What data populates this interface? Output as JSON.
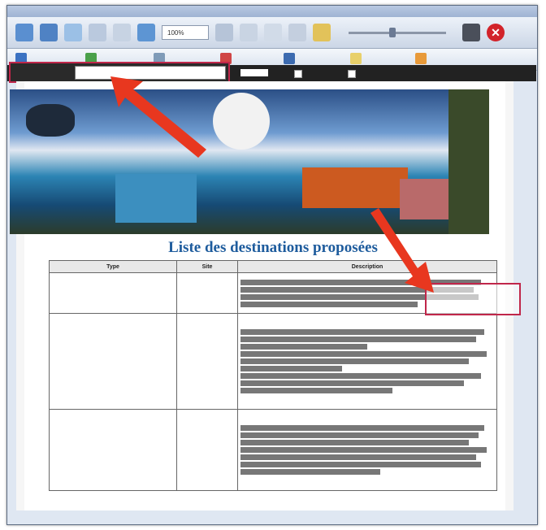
{
  "window": {
    "title": ""
  },
  "toolbar": {
    "zoom_value": "100%",
    "icons": [
      "back-icon",
      "forward-icon",
      "home-icon",
      "print-icon",
      "save-icon",
      "zoom-icon",
      "search-icon",
      "cut-icon",
      "refresh-icon",
      "folder-icon",
      "gear-icon",
      "close-icon"
    ]
  },
  "bookmarks": {
    "items": [
      "",
      "",
      "",
      "",
      "",
      "",
      ""
    ]
  },
  "form_bar": {
    "field_label": "",
    "field_value": ""
  },
  "page": {
    "heading": "Liste des destinations proposées",
    "table": {
      "headers": [
        "Type",
        "Site",
        "Description"
      ],
      "rows": [
        {
          "type": "",
          "site": "",
          "description": ""
        },
        {
          "type": "",
          "site": "",
          "description": ""
        },
        {
          "type": "",
          "site": "",
          "description": ""
        }
      ]
    }
  },
  "annotations": {
    "highlight_color": "#c0264a",
    "arrow_color": "#e8371f"
  },
  "colors": {
    "heading": "#1e5c9d",
    "dark_bar": "#222222",
    "link": "#3a5ab4"
  }
}
